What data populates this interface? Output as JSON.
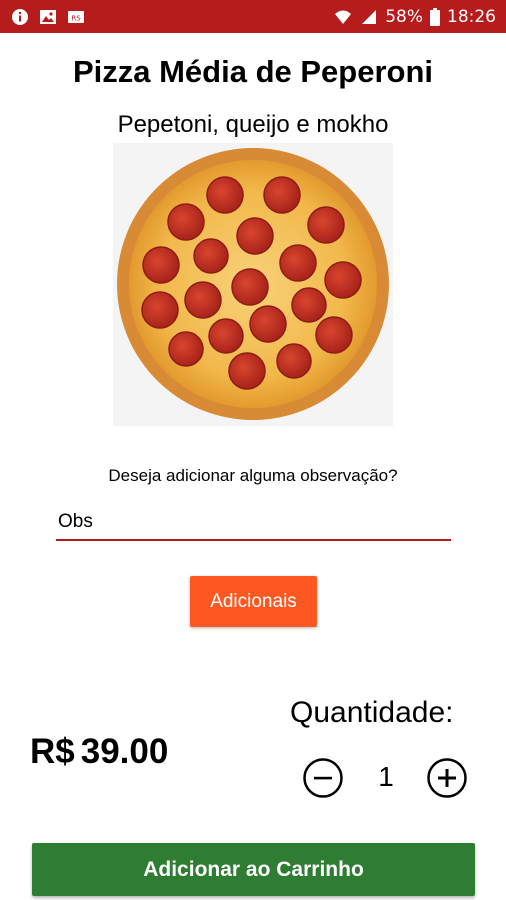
{
  "status_bar": {
    "left_icons": [
      "info-icon",
      "image-icon",
      "notification-icon"
    ],
    "battery": "58%",
    "time": "18:26"
  },
  "product": {
    "title": "Pizza Média de Peperoni",
    "description": "Pepetoni, queijo e mokho",
    "image_icon": "pepperoni-pizza-image"
  },
  "observation": {
    "question": "Deseja adicionar alguma observação?",
    "placeholder": "Obs",
    "value": ""
  },
  "extras_button": {
    "label": "Adicionais"
  },
  "price": {
    "currency": "R$",
    "amount": "39.00"
  },
  "quantity": {
    "label": "Quantidade:",
    "value": "1",
    "decrement_icon": "minus-circle-icon",
    "increment_icon": "plus-circle-icon"
  },
  "cart_button": {
    "label": "Adicionar ao Carrinho"
  },
  "colors": {
    "status_bar": "#b71c1c",
    "field_underline": "#b71c1c",
    "extras_button": "#ff5722",
    "cart_button": "#2e7d32"
  }
}
